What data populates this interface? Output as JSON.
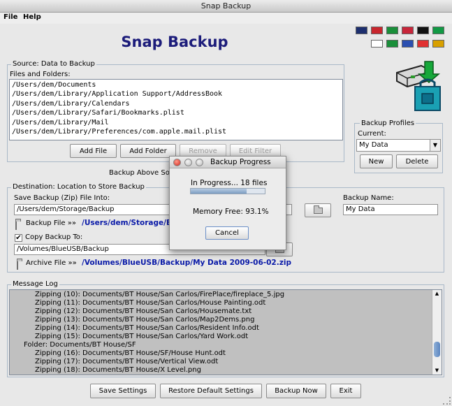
{
  "window": {
    "title": "Snap Backup"
  },
  "menu": {
    "file": "File",
    "help": "Help"
  },
  "app": {
    "title": "Snap Backup"
  },
  "flags": [
    {
      "name": "new-zealand-flag",
      "color": "#1d2f6e"
    },
    {
      "name": "netherlands-flag",
      "color": "#c8262d"
    },
    {
      "name": "brazil-flag",
      "color": "#1a8f3a"
    },
    {
      "name": "nepal-flag",
      "color": "#c8263a"
    },
    {
      "name": "germany-flag",
      "color": "#111111"
    },
    {
      "name": "italy-flag",
      "color": "#119944"
    },
    {
      "name": "korea-flag",
      "color": "#ffffff"
    },
    {
      "name": "brazil-flag-2",
      "color": "#1a8f3a"
    },
    {
      "name": "slovenia-flag",
      "color": "#2b4fb0"
    },
    {
      "name": "russia-flag",
      "color": "#e03030"
    },
    {
      "name": "spain-flag",
      "color": "#d8a000"
    }
  ],
  "source": {
    "legend": "Source: Data to Backup",
    "list_label": "Files and Folders:",
    "items": [
      "/Users/dem/Documents",
      "/Users/dem/Library/Application Support/AddressBook",
      "/Users/dem/Library/Calendars",
      "/Users/dem/Library/Safari/Bookmarks.plist",
      "/Users/dem/Library/Mail",
      "/Users/dem/Library/Preferences/com.apple.mail.plist"
    ],
    "add_file": "Add File",
    "add_folder": "Add Folder",
    "remove": "Remove",
    "edit_filter": "Edit Filter"
  },
  "profiles": {
    "legend": "Backup Profiles",
    "current_label": "Current:",
    "current_value": "My Data",
    "new": "New",
    "delete": "Delete"
  },
  "backup_above": "Backup Above Sou",
  "destination": {
    "legend": "Destination: Location to Store Backup",
    "save_label": "Save Backup (Zip) File Into:",
    "save_path": "/Users/dem/Storage/Backup",
    "backup_file_label": "Backup File »»",
    "backup_file_path": "/Users/dem/Storage/Bac",
    "backup_name_label": "Backup Name:",
    "backup_name_value": "My Data",
    "copy_label": "Copy Backup To:",
    "copy_checked": "✔",
    "copy_path": "/Volumes/BlueUSB/Backup",
    "archive_label": "Archive File »»",
    "archive_path": "/Volumes/BlueUSB/Backup/My Data 2009-06-02.zip"
  },
  "log": {
    "legend": "Message Log",
    "lines": [
      "Zipping (10): Documents/BT House/San Carlos/FirePlace/fireplace_5.jpg",
      "Zipping (11): Documents/BT House/San Carlos/House Painting.odt",
      "Zipping (12): Documents/BT House/San Carlos/Housemate.txt",
      "Zipping (13): Documents/BT House/San Carlos/Map2Dems.png",
      "Zipping (14): Documents/BT House/San Carlos/Resident Info.odt",
      "Zipping (15): Documents/BT House/San Carlos/Yard Work.odt",
      "Folder: Documents/BT House/SF",
      "Zipping (16): Documents/BT House/SF/House Hunt.odt",
      "Zipping (17): Documents/BT House/Vertical View.odt",
      "Zipping (18): Documents/BT House/X Level.png"
    ],
    "indent": [
      true,
      true,
      true,
      true,
      true,
      true,
      false,
      true,
      true,
      true
    ],
    "scroll_fraction": 0.82
  },
  "bottom": {
    "save_settings": "Save Settings",
    "restore_defaults": "Restore Default Settings",
    "backup_now": "Backup Now",
    "exit": "Exit"
  },
  "dialog": {
    "title": "Backup Progress",
    "status": "In Progress... 18 files",
    "progress": 0.75,
    "memory": "Memory Free: 93.1%",
    "cancel": "Cancel"
  }
}
